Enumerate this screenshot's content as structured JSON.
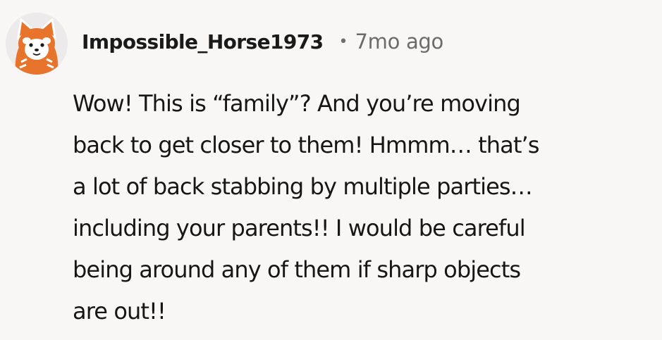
{
  "comment": {
    "avatar_icon": "red-panda-avatar-icon",
    "username": "Impossible_Horse1973",
    "separator": "•",
    "timestamp": "7mo ago",
    "body": "Wow! This is “family”? And you’re moving\nback to get closer to them! Hmmm… that’s\na lot of back stabbing by multiple parties…\nincluding your parents!! I would be careful\nbeing around any of them if sharp objects\nare out!!"
  },
  "colors": {
    "background": "#f8f7f6",
    "text": "#161616",
    "muted": "#6b6b6b",
    "avatar_orange": "#e8732a"
  }
}
